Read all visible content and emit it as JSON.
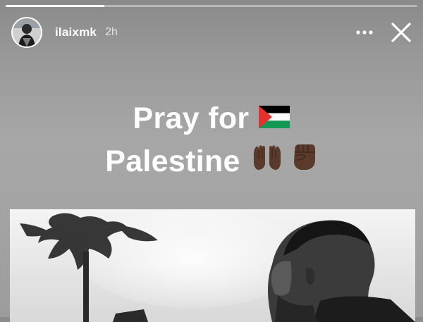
{
  "story": {
    "progress": 0.24,
    "username": "ilaixmk",
    "time_ago": "2h",
    "more_icon": "more-horizontal-icon",
    "close_icon": "close-icon"
  },
  "caption": {
    "line1": "Pray for",
    "line1_emoji": "palestine-flag",
    "line2": "Palestine",
    "line2_emojis": [
      "raised-hands-dark-skin-tone",
      "raised-fist-dark-skin-tone"
    ]
  },
  "photo": {
    "description_icon": "photo-monochrome"
  },
  "colors": {
    "flag_black": "#000000",
    "flag_white": "#ffffff",
    "flag_green": "#149954",
    "flag_red": "#e4312b",
    "skin_dark": "#5a3a2a"
  }
}
